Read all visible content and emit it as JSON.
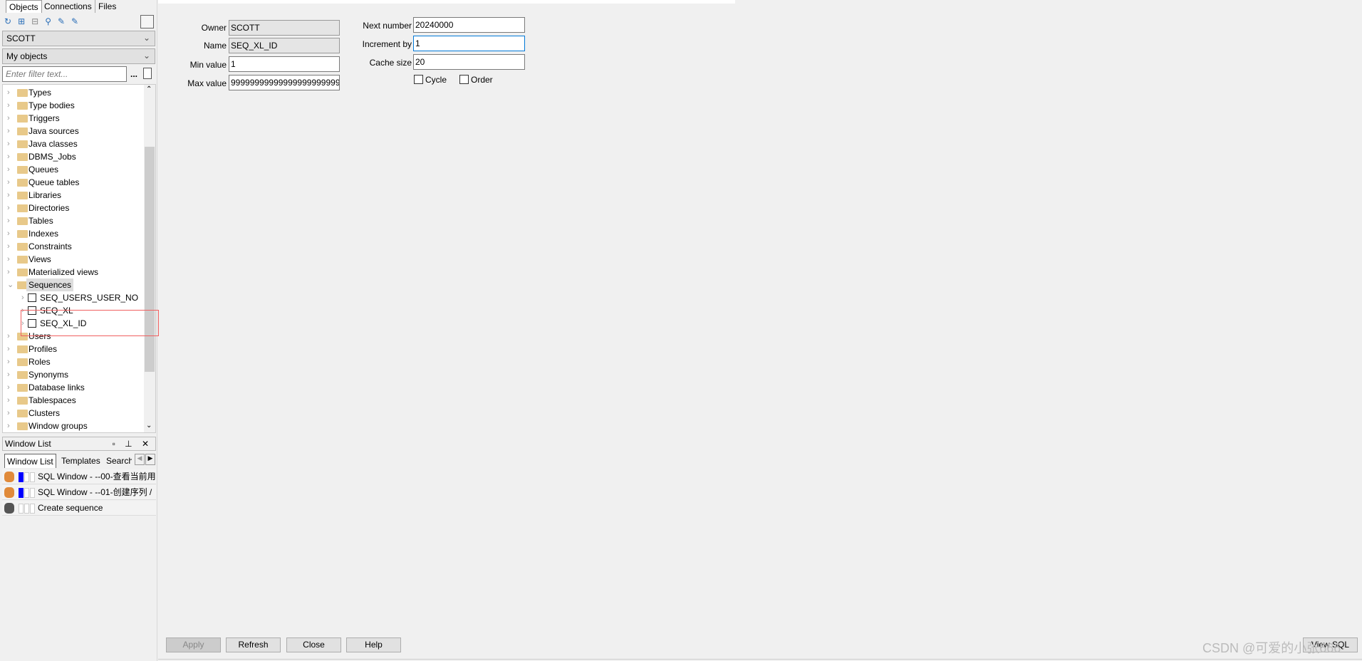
{
  "left_panel": {
    "tabs": [
      "Objects",
      "Connections",
      "Files"
    ],
    "toolbar_icons": [
      "refresh-icon",
      "expand-icon",
      "collapse-icon",
      "find-icon",
      "filter-icon",
      "folder-filter-icon"
    ],
    "schema": "SCOTT",
    "object_filter": "My objects",
    "filter_placeholder": "Enter filter text...",
    "filter_more": "...",
    "tree": [
      {
        "label": "Types",
        "type": "folder"
      },
      {
        "label": "Type bodies",
        "type": "folder"
      },
      {
        "label": "Triggers",
        "type": "folder"
      },
      {
        "label": "Java sources",
        "type": "folder"
      },
      {
        "label": "Java classes",
        "type": "folder"
      },
      {
        "label": "DBMS_Jobs",
        "type": "folder"
      },
      {
        "label": "Queues",
        "type": "folder"
      },
      {
        "label": "Queue tables",
        "type": "folder"
      },
      {
        "label": "Libraries",
        "type": "folder"
      },
      {
        "label": "Directories",
        "type": "folder"
      },
      {
        "label": "Tables",
        "type": "folder"
      },
      {
        "label": "Indexes",
        "type": "folder"
      },
      {
        "label": "Constraints",
        "type": "folder"
      },
      {
        "label": "Views",
        "type": "folder"
      },
      {
        "label": "Materialized views",
        "type": "folder"
      },
      {
        "label": "Sequences",
        "type": "folder",
        "expanded": true
      },
      {
        "label": "SEQ_USERS_USER_NO",
        "type": "sequence"
      },
      {
        "label": "SEQ_XL",
        "type": "sequence"
      },
      {
        "label": "SEQ_XL_ID",
        "type": "sequence",
        "highlighted": true
      },
      {
        "label": "Users",
        "type": "folder"
      },
      {
        "label": "Profiles",
        "type": "folder"
      },
      {
        "label": "Roles",
        "type": "folder"
      },
      {
        "label": "Synonyms",
        "type": "folder"
      },
      {
        "label": "Database links",
        "type": "folder"
      },
      {
        "label": "Tablespaces",
        "type": "folder"
      },
      {
        "label": "Clusters",
        "type": "folder"
      },
      {
        "label": "Window groups",
        "type": "folder"
      }
    ]
  },
  "window_list": {
    "title": "Window List",
    "tabs": [
      "Window List",
      "Templates",
      "Search"
    ],
    "items": [
      {
        "label": "SQL Window - --00-查看当前用",
        "active": true
      },
      {
        "label": "SQL Window - --01-创建序列 /",
        "active": true
      },
      {
        "label": "Create sequence",
        "active": false
      }
    ]
  },
  "form": {
    "owner_label": "Owner",
    "owner": "SCOTT",
    "name_label": "Name",
    "name": "SEQ_XL_ID",
    "min_label": "Min value",
    "min": "1",
    "max_label": "Max value",
    "max": "9999999999999999999999999999",
    "next_label": "Next number",
    "next": "20240000",
    "increment_label": "Increment by",
    "increment": "1",
    "cache_label": "Cache size",
    "cache": "20",
    "cycle_label": "Cycle",
    "cycle": false,
    "order_label": "Order",
    "order": false
  },
  "buttons": {
    "apply": "Apply",
    "refresh": "Refresh",
    "close": "Close",
    "help": "Help",
    "view_sql": "View SQL"
  },
  "watermark": "CSDN @可爱的小张666",
  "colors": {
    "highlight_box": "#f06060",
    "folder": "#e8c98a",
    "active_bar": "#0000ff",
    "focus_border": "#0078d7"
  }
}
